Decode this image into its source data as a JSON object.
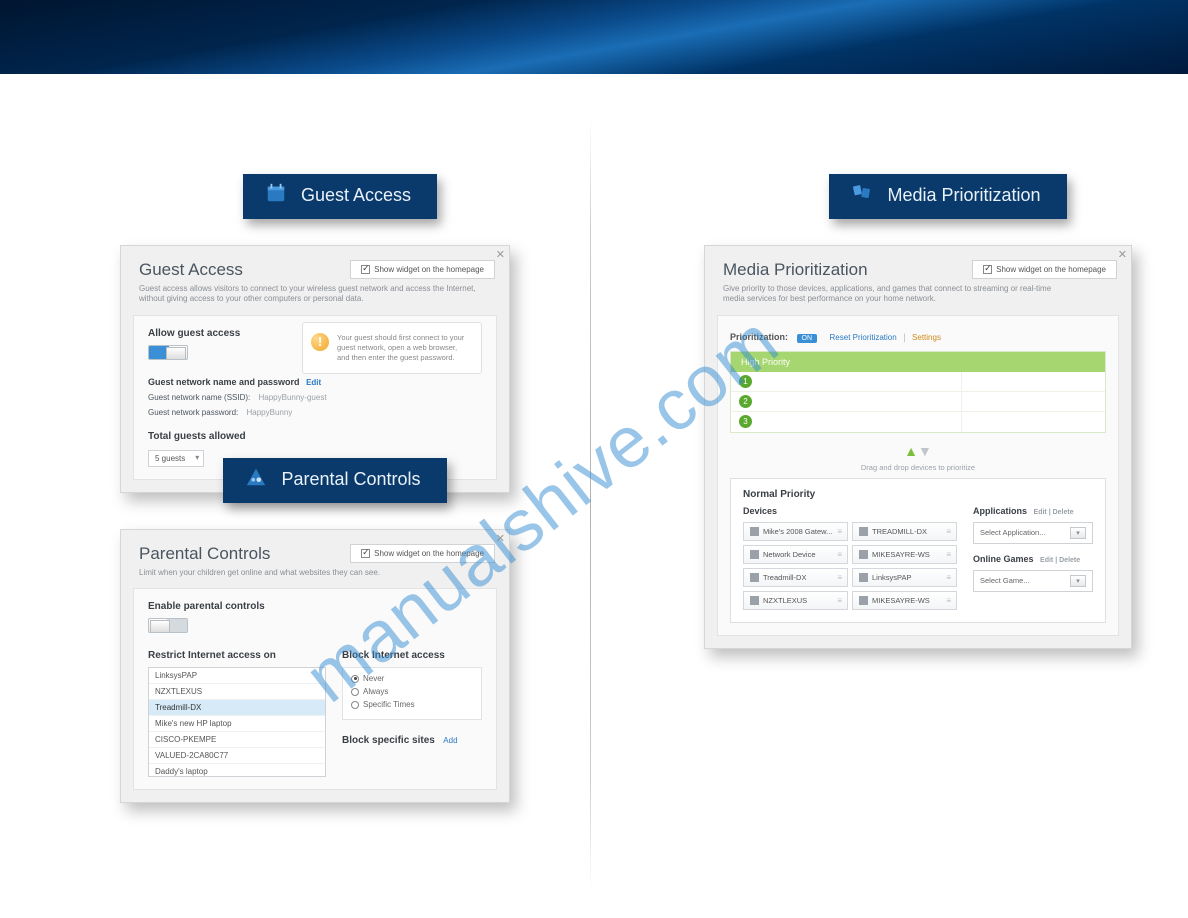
{
  "watermark": "manualshive.com",
  "guest_access": {
    "banner": "Guest Access",
    "title": "Guest Access",
    "subtitle": "Guest access allows visitors to connect to your wireless guest network and access the Internet, without giving access to your other computers or personal data.",
    "show_widget": "Show widget on the homepage",
    "allow_label": "Allow guest access",
    "callout": "Your guest should first connect to your guest network, open a web browser, and then enter the guest password.",
    "name_pw_label": "Guest network name and password",
    "edit_link": "Edit",
    "ssid_label": "Guest network name (SSID):",
    "ssid_value": "HappyBunny-guest",
    "pw_label": "Guest network password:",
    "pw_value": "HappyBunny",
    "total_label": "Total guests allowed",
    "total_value": "5 guests"
  },
  "parental_controls": {
    "banner": "Parental Controls",
    "title": "Parental Controls",
    "subtitle": "Limit when your children get online and what websites they can see.",
    "show_widget": "Show widget on the homepage",
    "enable_label": "Enable parental controls",
    "restrict_label": "Restrict Internet access on",
    "devices": [
      {
        "name": "LinksysPAP",
        "selected": false
      },
      {
        "name": "NZXTLEXUS",
        "selected": false
      },
      {
        "name": "Treadmill-DX",
        "selected": true
      },
      {
        "name": "Mike's new HP laptop",
        "selected": false
      },
      {
        "name": "CISCO-PKEMPE",
        "selected": false
      },
      {
        "name": "VALUED-2CA80C77",
        "selected": false
      },
      {
        "name": "Daddy's laptop",
        "selected": false
      }
    ],
    "block_label": "Block Internet access",
    "radios": [
      {
        "label": "Never",
        "checked": true
      },
      {
        "label": "Always",
        "checked": false
      },
      {
        "label": "Specific Times",
        "checked": false
      }
    ],
    "block_sites_label": "Block specific sites",
    "add_link": "Add"
  },
  "media_prioritization": {
    "banner": "Media Prioritization",
    "title": "Media Prioritization",
    "subtitle": "Give priority to those devices, applications, and games that connect to streaming or real-time media services for best performance on your home network.",
    "show_widget": "Show widget on the homepage",
    "tab_label": "Prioritization:",
    "tab_on": "ON",
    "tab_reset": "Reset Prioritization",
    "tab_sep": "|",
    "tab_settings": "Settings",
    "high_priority_label": "High Priority",
    "hp_slots": [
      "1",
      "2",
      "3"
    ],
    "drag_hint": "Drag and drop devices to prioritize",
    "normal_priority_label": "Normal Priority",
    "devices_label": "Devices",
    "device_list_left": [
      "Mike's 2008 Gatew...",
      "Network Device",
      "Treadmill-DX",
      "NZXTLEXUS"
    ],
    "device_list_right": [
      "TREADMILL-DX",
      "MIKESAYRE-WS",
      "LinksysPAP",
      "MIKESAYRE-WS"
    ],
    "applications_label": "Applications",
    "app_links": "Edit  |  Delete",
    "app_select_placeholder": "Select Application...",
    "games_label": "Online Games",
    "games_links": "Edit  |  Delete",
    "games_select_placeholder": "Select Game..."
  }
}
